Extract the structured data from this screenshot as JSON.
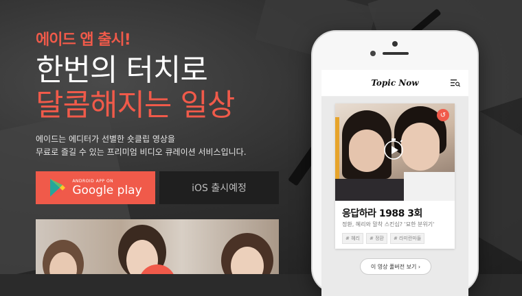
{
  "promo": {
    "badge": "에이드 앱 출시!",
    "headline_line1": "한번의 터치로",
    "headline_line2": "달콤해지는 일상",
    "description_line1": "에이드는 에디터가 선별한 숏클립 영상을",
    "description_line2": "무료로 즐길 수 있는 프리미엄 비디오 큐레이션 서비스입니다."
  },
  "store_buttons": {
    "google_small": "ANDROID APP ON",
    "google_big": "Google play",
    "ios_label": "iOS 출시예정"
  },
  "phone": {
    "app_logo": "Topic Now",
    "card": {
      "title": "응답하라 1988 3회",
      "subtitle": "정환, 혜리와 말착 스킨십? '묘한 분위기'",
      "tags": [
        "# 혜리",
        "# 정환",
        "# 라미란마들"
      ]
    },
    "watch_button": "이 영상 풀버전 보기 ›"
  },
  "colors": {
    "accent": "#f05a4a",
    "background": "#2b2b2b"
  }
}
